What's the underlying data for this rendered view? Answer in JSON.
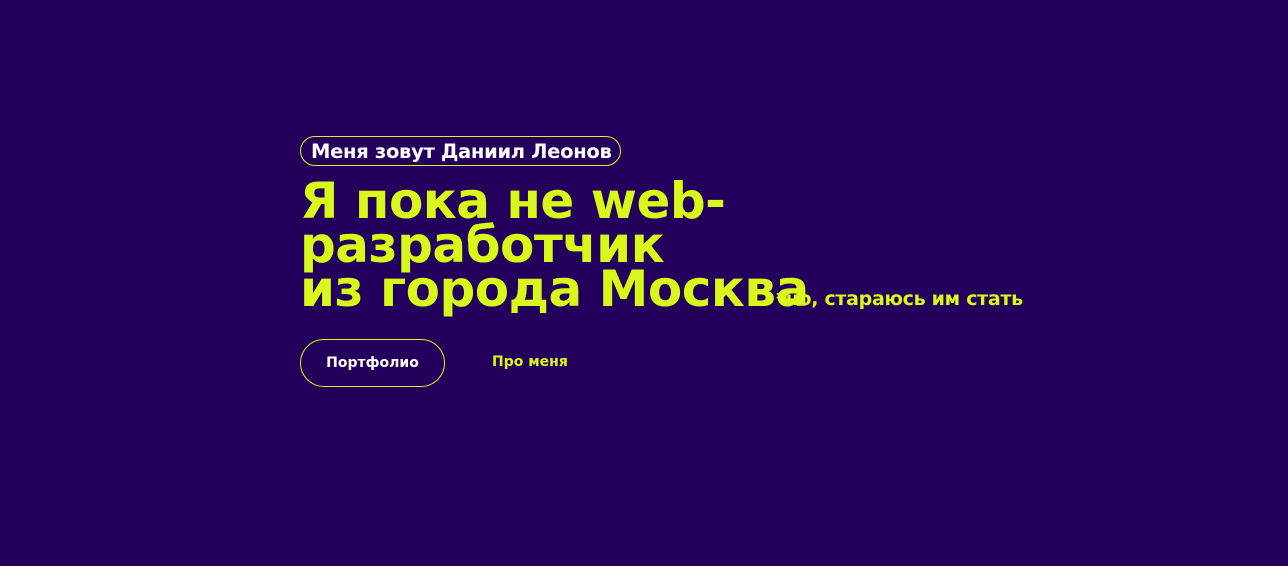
{
  "colors": {
    "background": "#23005b",
    "accent": "#d8f71a",
    "text_light": "#ffffff"
  },
  "hero": {
    "name_badge": "Меня зовут Даниил Леонов",
    "headline_lines": [
      "Я пока не web-",
      "разработчик",
      "из города Москва"
    ],
    "footnote": "*но, стараюсь им стать"
  },
  "actions": {
    "portfolio_label": "Портфолио",
    "about_label": "Про меня"
  }
}
